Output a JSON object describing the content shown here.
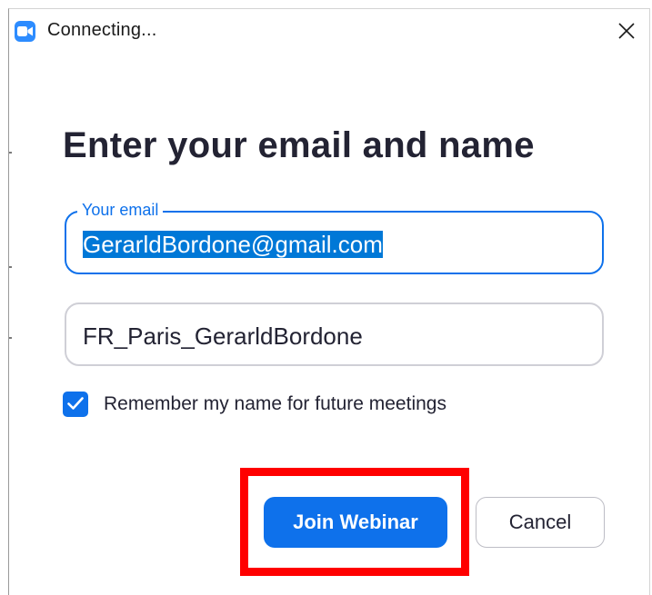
{
  "window": {
    "title": "Connecting...",
    "app_icon": "zoom-camera-icon",
    "close_icon": "close-icon"
  },
  "form": {
    "heading": "Enter your email and name",
    "email": {
      "label": "Your email",
      "value": "GerarldBordone@gmail.com",
      "text_selected": true
    },
    "name": {
      "value": "FR_Paris_GerarldBordone"
    },
    "remember": {
      "label": "Remember my name for future meetings",
      "checked": true
    }
  },
  "actions": {
    "join_label": "Join Webinar",
    "cancel_label": "Cancel",
    "join_highlighted": true
  },
  "colors": {
    "accent": "#0e71eb",
    "selection": "#0078d7",
    "highlight": "#ff0000",
    "heading_text": "#232333"
  }
}
